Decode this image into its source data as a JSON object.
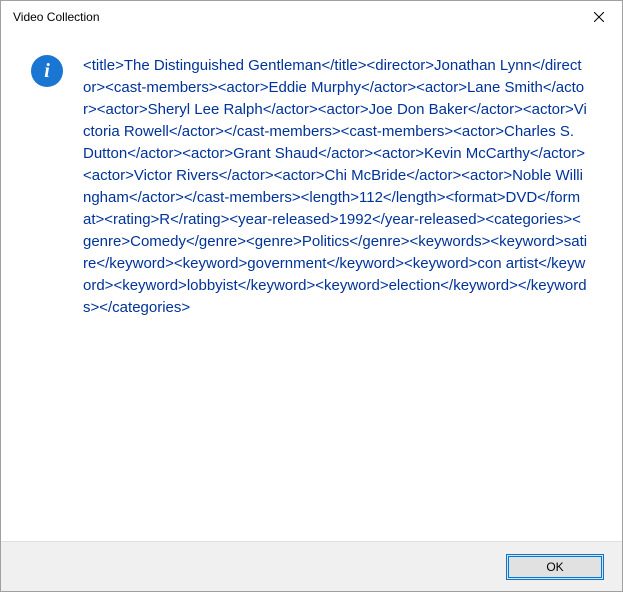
{
  "window": {
    "title": "Video Collection"
  },
  "message": {
    "text": "<title>The Distinguished Gentleman</title><director>Jonathan Lynn</director><cast-members><actor>Eddie Murphy</actor><actor>Lane Smith</actor><actor>Sheryl Lee Ralph</actor><actor>Joe Don Baker</actor><actor>Victoria Rowell</actor></cast-members><cast-members><actor>Charles S. Dutton</actor><actor>Grant Shaud</actor><actor>Kevin McCarthy</actor><actor>Victor Rivers</actor><actor>Chi McBride</actor><actor>Noble Willingham</actor></cast-members><length>112</length><format>DVD</format><rating>R</rating><year-released>1992</year-released><categories><genre>Comedy</genre><genre>Politics</genre><keywords><keyword>satire</keyword><keyword>government</keyword><keyword>con artist</keyword><keyword>lobbyist</keyword><keyword>election</keyword></keywords></categories>"
  },
  "buttons": {
    "ok": "OK"
  }
}
